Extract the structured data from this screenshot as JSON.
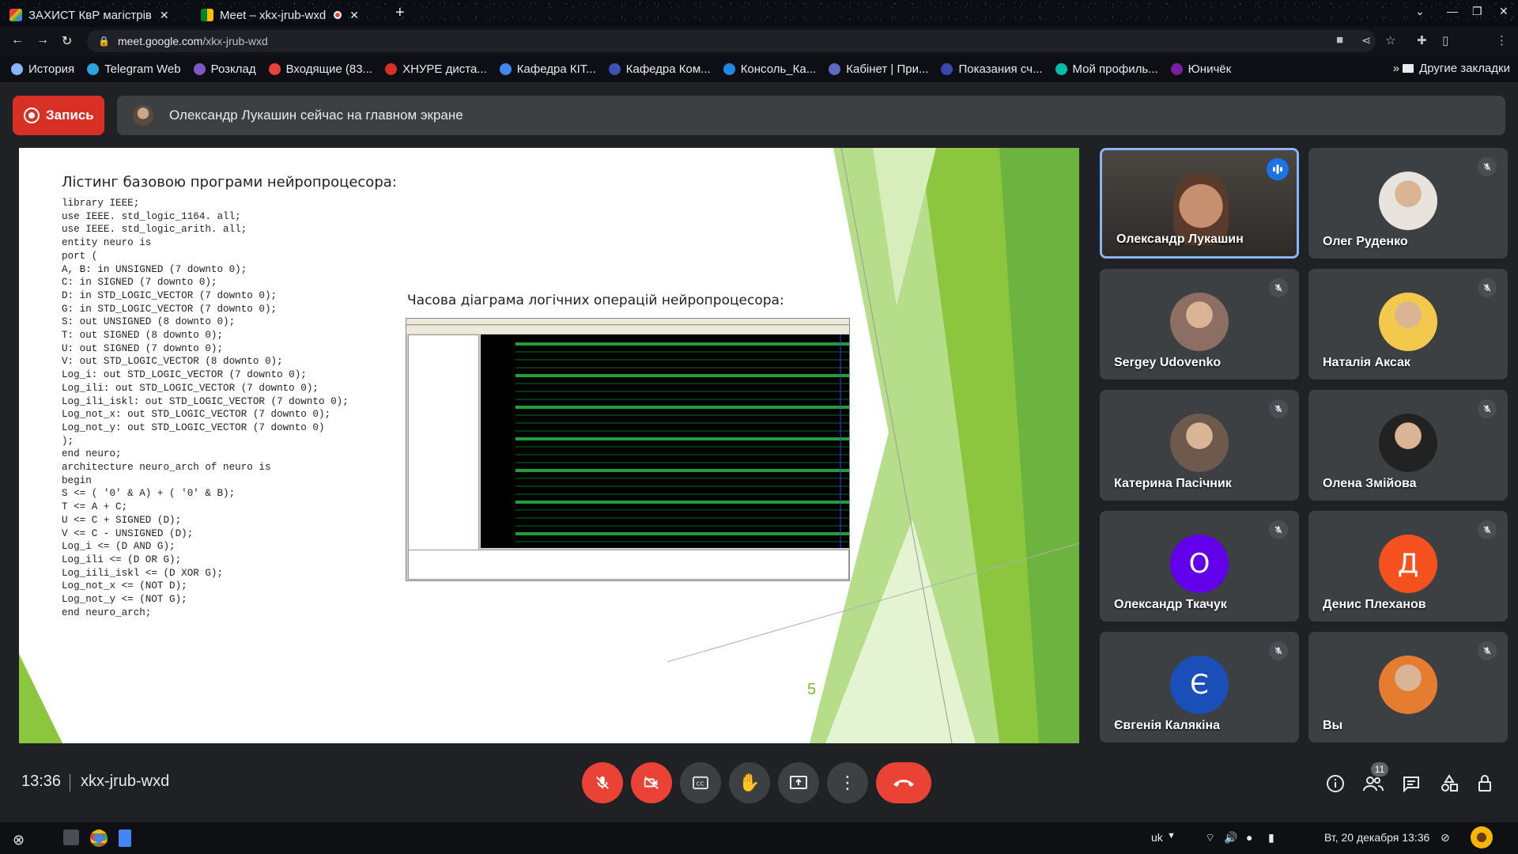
{
  "browser": {
    "tabs": [
      {
        "title": "ЗАХИСТ КвР магістрів"
      },
      {
        "title": "Meet – xkx-jrub-wxd"
      }
    ],
    "new_tab": "+",
    "address": {
      "host": "meet.google.com",
      "path": "/xkx-jrub-wxd"
    },
    "bookmarks": [
      {
        "label": "История",
        "icon": "history-icon",
        "color": "#8ab4f8"
      },
      {
        "label": "Telegram Web",
        "icon": "telegram-icon",
        "color": "#2aa3e0"
      },
      {
        "label": "Розклад",
        "icon": "schedule-icon",
        "color": "#7e57c2"
      },
      {
        "label": "Входящие (83...",
        "icon": "gmail-icon",
        "color": "#ea4335"
      },
      {
        "label": "ХНУРЕ диста...",
        "icon": "nure-icon",
        "color": "#d93025"
      },
      {
        "label": "Кафедра КІТ...",
        "icon": "department-icon",
        "color": "#4285f4"
      },
      {
        "label": "Кафедра Ком...",
        "icon": "department2-icon",
        "color": "#3f51b5"
      },
      {
        "label": "Консоль_Ка...",
        "icon": "console-icon",
        "color": "#1e88e5"
      },
      {
        "label": "Кабінет | При...",
        "icon": "cabinet-icon",
        "color": "#5c6bc0"
      },
      {
        "label": "Показания сч...",
        "icon": "meter-icon",
        "color": "#3949ab"
      },
      {
        "label": "Мой профиль...",
        "icon": "profile-icon",
        "color": "#00bfa5"
      },
      {
        "label": "Юничёк",
        "icon": "yunichek-icon",
        "color": "#7b1fa2"
      }
    ],
    "bookmarks_more": "»",
    "other_bookmarks": "Другие закладки"
  },
  "meet": {
    "record_label": "Запись",
    "banner_text": "Олександр Лукашин сейчас на главном экране",
    "time": "13:36",
    "meeting_code": "xkx-jrub-wxd",
    "participants_count": "11",
    "participants": [
      {
        "name": "Олександр Лукашин",
        "type": "video",
        "speaking": true
      },
      {
        "name": "Олег Руденко",
        "type": "photo",
        "color": "#e8e3dc"
      },
      {
        "name": "Sergey Udovenko",
        "type": "photo",
        "color": "#8d6e63"
      },
      {
        "name": "Наталія Аксак",
        "type": "photo",
        "color": "#f2c94c"
      },
      {
        "name": "Катерина Пасічник",
        "type": "photo",
        "color": "#6d5a4c"
      },
      {
        "name": "Олена Змійова",
        "type": "photo",
        "color": "#222222"
      },
      {
        "name": "Олександр Ткачук",
        "type": "letter",
        "letter": "О",
        "color": "#6200ea"
      },
      {
        "name": "Денис Плеханов",
        "type": "letter",
        "letter": "Д",
        "color": "#f4511e"
      },
      {
        "name": "Євгенія Калякіна",
        "type": "letter",
        "letter": "Є",
        "color": "#1a4fba"
      },
      {
        "name": "Вы",
        "type": "photo",
        "color": "#e67c2f"
      }
    ]
  },
  "slide": {
    "title": "Лістинг базовою програми нейропроцесора:",
    "code_lines": [
      "library IEEE;",
      "use IEEE. std_logic_1164. all;",
      "use IEEE. std_logic_arith. all;",
      "entity neuro is",
      "port (",
      "A, B: in UNSIGNED (7 downto 0);",
      "C: in SIGNED (7 downto 0);",
      "D: in STD_LOGIC_VECTOR (7 downto 0);",
      "G: in STD_LOGIC_VECTOR (7 downto 0);",
      "S: out UNSIGNED (8 downto 0);",
      "T: out SIGNED (8 downto 0);",
      "U: out SIGNED (7 downto 0);",
      "V: out STD_LOGIC_VECTOR (8 downto 0);",
      "Log_i: out STD_LOGIC_VECTOR (7 downto 0);",
      "Log_ili: out STD_LOGIC_VECTOR (7 downto 0);",
      "Log_ili_iskl: out STD_LOGIC_VECTOR (7 downto 0);",
      "Log_not_x: out STD_LOGIC_VECTOR (7 downto 0);",
      "Log_not_y: out STD_LOGIC_VECTOR (7 downto 0)",
      ");",
      "end neuro;",
      "architecture neuro_arch of neuro is",
      "begin",
      "S <= ( '0' & A) + ( '0' & B);",
      "T <= A + C;",
      "U <= C + SIGNED (D);",
      "V <= C - UNSIGNED (D);",
      "Log_i <= (D AND G);",
      "Log_ili <= (D OR G);",
      "Log_iili_iskl <= (D XOR G);",
      "Log_not_x <= (NOT D);",
      "Log_not_y <= (NOT G);",
      "end neuro_arch;"
    ],
    "diagram_title": "Часова діаграма логічних операцій нейропроцесора:",
    "page_number": "5",
    "accent_color": "#7dbb2c"
  },
  "taskbar": {
    "language": "uk",
    "datetime": "Вт, 20 декабря  13:36"
  }
}
